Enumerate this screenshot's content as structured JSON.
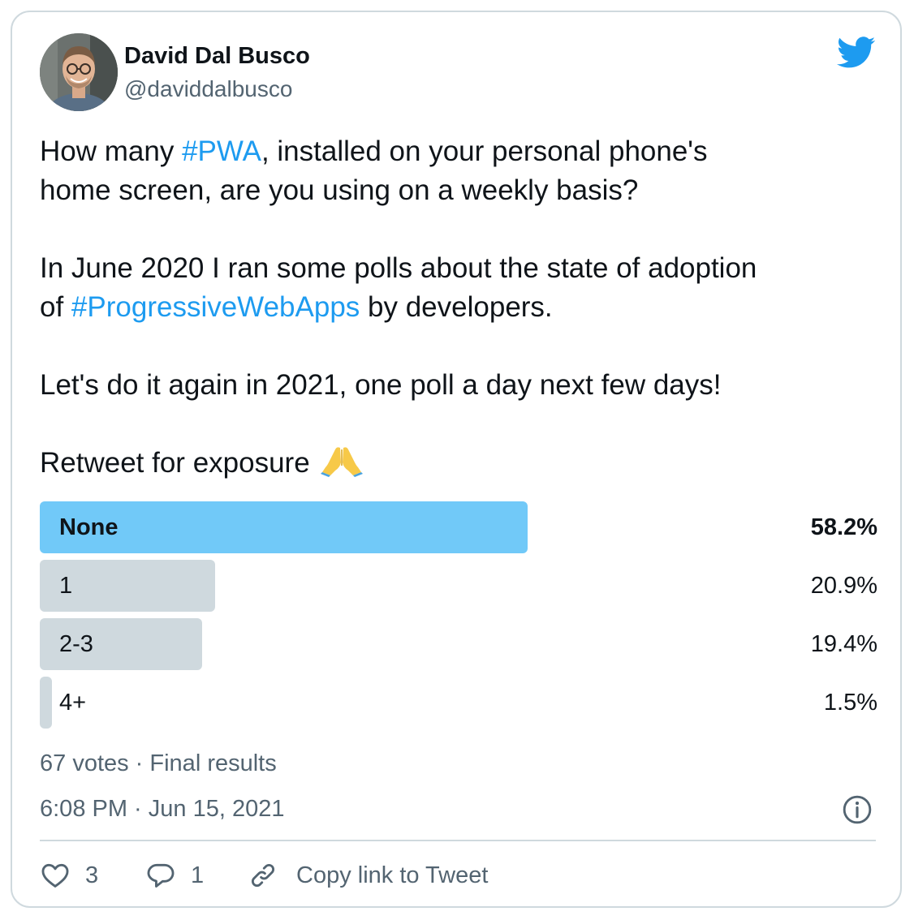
{
  "author": {
    "name": "David Dal Busco",
    "handle": "@daviddalbusco"
  },
  "tweet": {
    "line1_pre": "How many ",
    "line1_tag": "#PWA",
    "line1_post": ", installed on your personal phone's",
    "line2": "home screen, are you using on a weekly basis?",
    "line3": "In June 2020 I ran some polls about the state of adoption",
    "line4_pre": "of ",
    "line4_tag": "#ProgressiveWebApps",
    "line4_post": " by developers.",
    "line5": "Let's do it again in 2021, one poll a day next few days!",
    "line6": "Retweet for exposure"
  },
  "poll": {
    "options": [
      {
        "label": "None",
        "percent_text": "58.2%",
        "percent": 58.2,
        "winner": true
      },
      {
        "label": "1",
        "percent_text": "20.9%",
        "percent": 20.9,
        "winner": false
      },
      {
        "label": "2-3",
        "percent_text": "19.4%",
        "percent": 19.4,
        "winner": false
      },
      {
        "label": "4+",
        "percent_text": "1.5%",
        "percent": 1.5,
        "winner": false
      }
    ],
    "summary": "67 votes · Final results"
  },
  "timestamp": "6:08 PM · Jun 15, 2021",
  "actions": {
    "likes": "3",
    "replies": "1",
    "copy_link": "Copy link to Tweet"
  },
  "colors": {
    "accent": "#1d9bf0",
    "winner_bar": "#71c9f8",
    "bar": "#cfd9de",
    "secondary_text": "#536471"
  },
  "icons": [
    "twitter-bird-icon",
    "folded-hands-emoji",
    "info-icon",
    "heart-icon",
    "reply-bubble-icon",
    "link-icon"
  ]
}
